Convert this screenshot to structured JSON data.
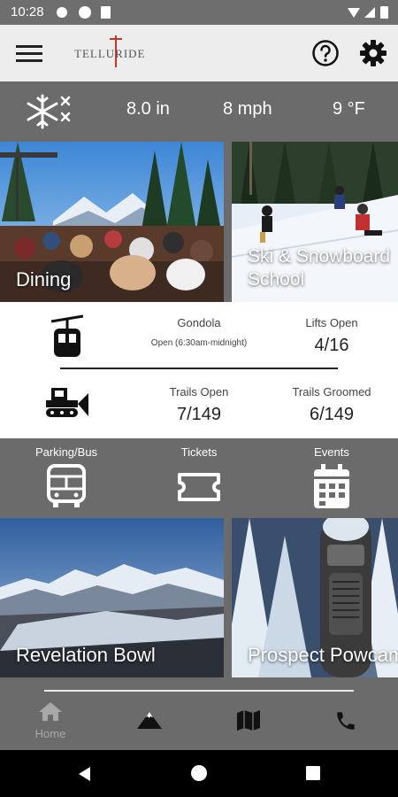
{
  "status_bar": {
    "time": "10:28"
  },
  "header": {
    "brand": "TELLURIDE"
  },
  "weather": {
    "snow": "8.0 in",
    "wind": "8 mph",
    "temp": "9 °F"
  },
  "tiles": {
    "dining": "Dining",
    "ski_school": "Ski & Snowboard School",
    "revelation": "Revelation Bowl",
    "prospect": "Prospect Powcam"
  },
  "status": {
    "gondola_label": "Gondola",
    "gondola_hours": "Open (6:30am-midnight)",
    "lifts_label": "Lifts Open",
    "lifts_value": "4/16",
    "trails_label": "Trails Open",
    "trails_value": "7/149",
    "groomed_label": "Trails Groomed",
    "groomed_value": "6/149"
  },
  "quick_links": {
    "parking": "Parking/Bus",
    "tickets": "Tickets",
    "events": "Events"
  },
  "bottom_nav": {
    "home": "Home"
  },
  "colors": {
    "gray": "#6b6b6b",
    "light": "#ededed",
    "brand_red": "#c0392b"
  }
}
